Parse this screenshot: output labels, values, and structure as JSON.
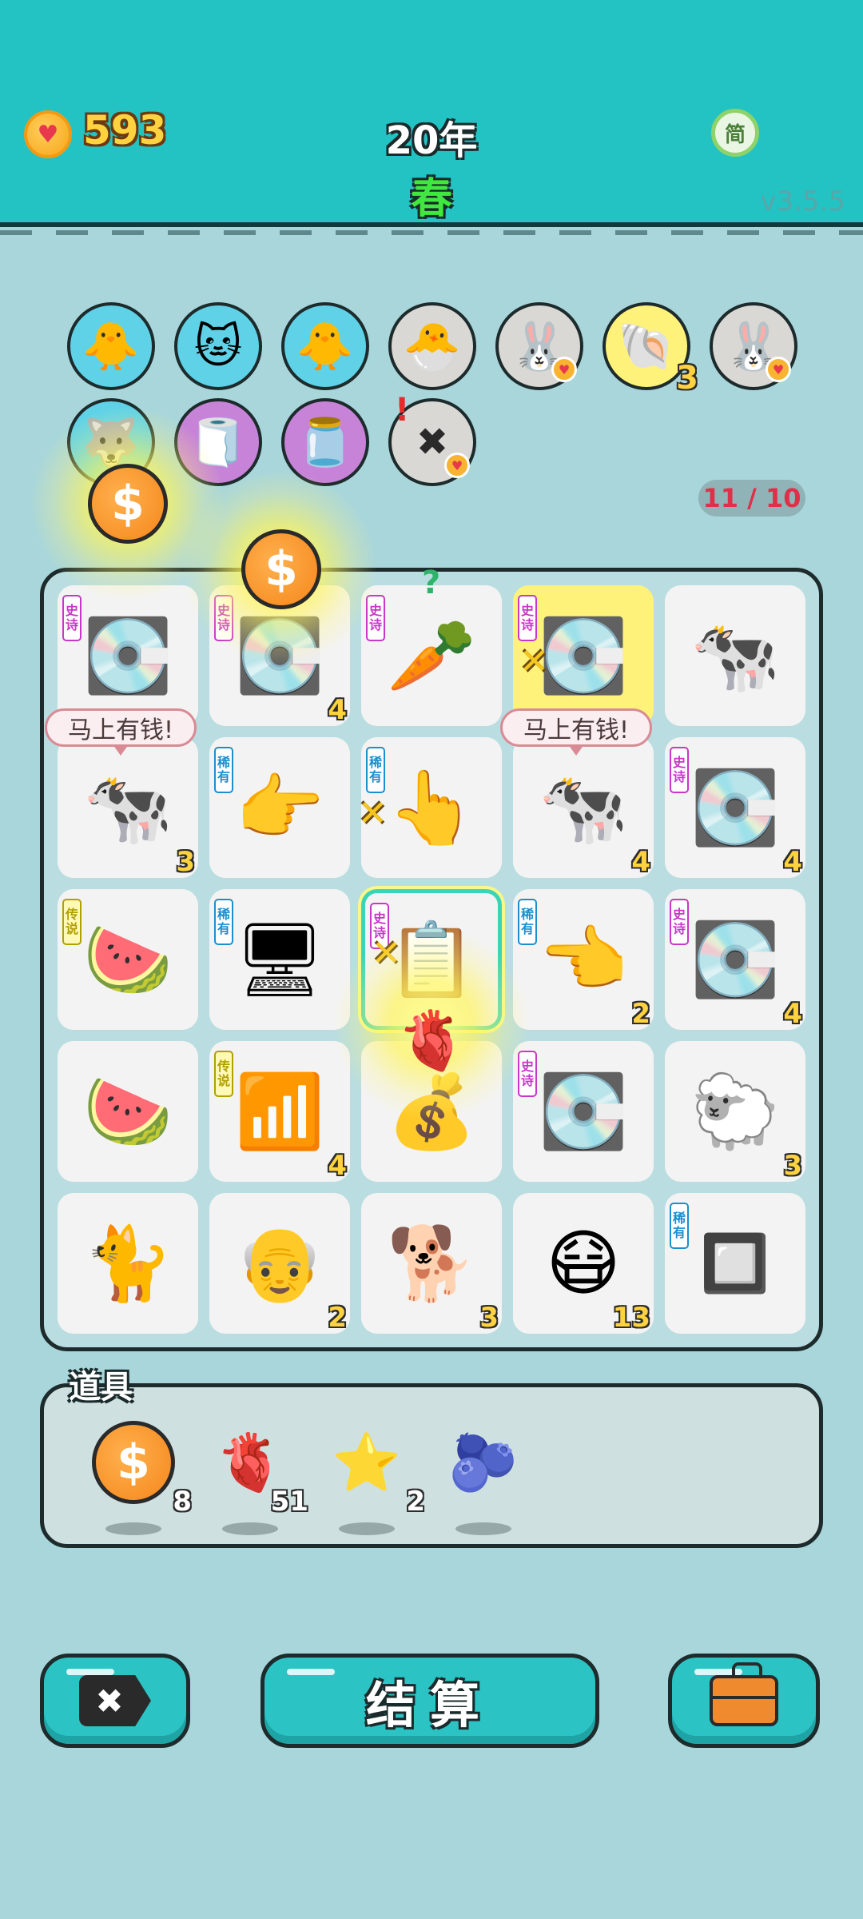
{
  "header": {
    "coins": "593",
    "year": "20年",
    "season": "春",
    "language_label": "简",
    "version": "v3.5.5"
  },
  "pets": [
    {
      "name": "chick-syringe",
      "emoji": "🐥",
      "bg": "#5fd2e8"
    },
    {
      "name": "cats-heart",
      "emoji": "🐱",
      "bg": "#5fd2e8"
    },
    {
      "name": "chick-syringe",
      "emoji": "🐥",
      "bg": "#5fd2e8"
    },
    {
      "name": "chick-egg",
      "emoji": "🐣",
      "bg": "#dad8d4"
    },
    {
      "name": "rabbit",
      "emoji": "🐰",
      "bg": "#dad8d4"
    },
    {
      "name": "shell",
      "emoji": "🐚",
      "bg": "#fff27a",
      "count": "3"
    },
    {
      "name": "rabbit",
      "emoji": "🐰",
      "bg": "#dad8d4"
    },
    {
      "name": "husky",
      "emoji": "🐺",
      "bg": "#5fd2e8"
    },
    {
      "name": "tissue-box",
      "emoji": "🧻",
      "bg": "#c783d8"
    },
    {
      "name": "jar",
      "emoji": "🫙",
      "bg": "#c783d8"
    },
    {
      "name": "remove-ticket",
      "emoji": "✖",
      "bg": "#dad8d4"
    }
  ],
  "capacity": "11 / 10",
  "board": {
    "speech_bubble": "马上有钱!",
    "tags": {
      "epic": "史诗",
      "rare": "稀有",
      "legend": "传说"
    },
    "cells": [
      {
        "icon": "gpu",
        "emoji": "💽",
        "tag": "epic",
        "count": ""
      },
      {
        "icon": "gpu",
        "emoji": "💽",
        "tag": "epic",
        "count": "4"
      },
      {
        "icon": "carrot",
        "emoji": "🥕",
        "tag": "epic",
        "count": ""
      },
      {
        "icon": "gpu",
        "emoji": "💽",
        "tag": "epic",
        "count": ""
      },
      {
        "icon": "cow-girl",
        "emoji": "🐄",
        "tag": "",
        "count": ""
      },
      {
        "icon": "cow-girl",
        "emoji": "🐄",
        "tag": "",
        "count": "3"
      },
      {
        "icon": "pointing-hand",
        "emoji": "👉",
        "tag": "rare",
        "count": ""
      },
      {
        "icon": "pointing-hand",
        "emoji": "👆",
        "tag": "rare",
        "count": ""
      },
      {
        "icon": "cow-girl",
        "emoji": "🐄",
        "tag": "",
        "count": "4"
      },
      {
        "icon": "gpu",
        "emoji": "💽",
        "tag": "epic",
        "count": "4"
      },
      {
        "icon": "watermelon",
        "emoji": "🍉",
        "tag": "legend",
        "count": ""
      },
      {
        "icon": "server",
        "emoji": "🖥",
        "tag": "rare",
        "count": ""
      },
      {
        "icon": "ctrl-c-v",
        "emoji": "📋",
        "tag": "epic",
        "count": ""
      },
      {
        "icon": "pointing-hand",
        "emoji": "👈",
        "tag": "rare",
        "count": "2"
      },
      {
        "icon": "gpu",
        "emoji": "💽",
        "tag": "epic",
        "count": "4"
      },
      {
        "icon": "watermelon-slice",
        "emoji": "🍉",
        "tag": "",
        "count": ""
      },
      {
        "icon": "wifi",
        "emoji": "📶",
        "tag": "legend",
        "count": "4"
      },
      {
        "icon": "coin-sack",
        "emoji": "💰",
        "tag": "",
        "count": ""
      },
      {
        "icon": "gpu",
        "emoji": "💽",
        "tag": "epic",
        "count": ""
      },
      {
        "icon": "sheep",
        "emoji": "🐑",
        "tag": "",
        "count": "3"
      },
      {
        "icon": "cat",
        "emoji": "🐈",
        "tag": "",
        "count": ""
      },
      {
        "icon": "old-man",
        "emoji": "👴",
        "tag": "",
        "count": "2"
      },
      {
        "icon": "dog",
        "emoji": "🐕",
        "tag": "",
        "count": "3"
      },
      {
        "icon": "masked-man",
        "emoji": "😷",
        "tag": "",
        "count": "13"
      },
      {
        "icon": "cpu",
        "emoji": "🔲",
        "tag": "rare",
        "count": ""
      }
    ]
  },
  "items": {
    "title": "道具",
    "list": [
      {
        "name": "coin",
        "emoji": "$",
        "count": "8"
      },
      {
        "name": "liver",
        "emoji": "🫀",
        "count": "51"
      },
      {
        "name": "star",
        "emoji": "⭐",
        "count": "2"
      },
      {
        "name": "blueberry",
        "emoji": "🫐",
        "count": ""
      }
    ]
  },
  "buttons": {
    "remove_icon": "✖",
    "settle_label": "结算",
    "bag_icon": "briefcase"
  },
  "colors": {
    "header": "#23c3c4",
    "background": "#a9d6db",
    "coin_text": "#ffd23f",
    "capacity_text": "#e02f48",
    "season_text": "#3ee83e"
  }
}
